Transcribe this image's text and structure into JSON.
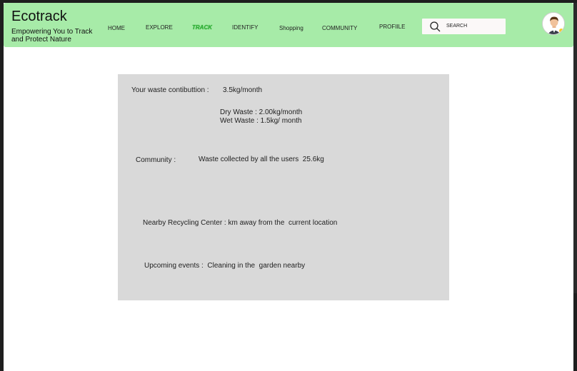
{
  "header": {
    "brand": "Ecotrack",
    "tagline_line1": "Empowering You to Track",
    "tagline_line2": "and Protect Nature"
  },
  "nav": {
    "home": "HOME",
    "explore": "EXPLORE",
    "track": "TRACK",
    "identify": "IDENTIFY",
    "shopping": "Shopping",
    "community": "COMMUNITY",
    "profile": "PROFIILE"
  },
  "search": {
    "placeholder": "SEARCH"
  },
  "colors": {
    "header_bg": "#a7eba8",
    "active_nav": "#2fae36",
    "panel_bg": "#d9d9d9"
  },
  "panel": {
    "contribution_label": "Your waste contibuttion :",
    "contribution_value": "3.5kg/month",
    "dry_waste": "Dry Waste : 2.00kg/month",
    "wet_waste": "Wet Waste : 1.5kg/ month",
    "community_label": "Community :",
    "community_text": "Waste collected by all the users  25.6kg",
    "recycling": "Nearby Recycling Center : km away from the  current location",
    "events": "Upcoming events :  Cleaning in the  garden nearby"
  }
}
